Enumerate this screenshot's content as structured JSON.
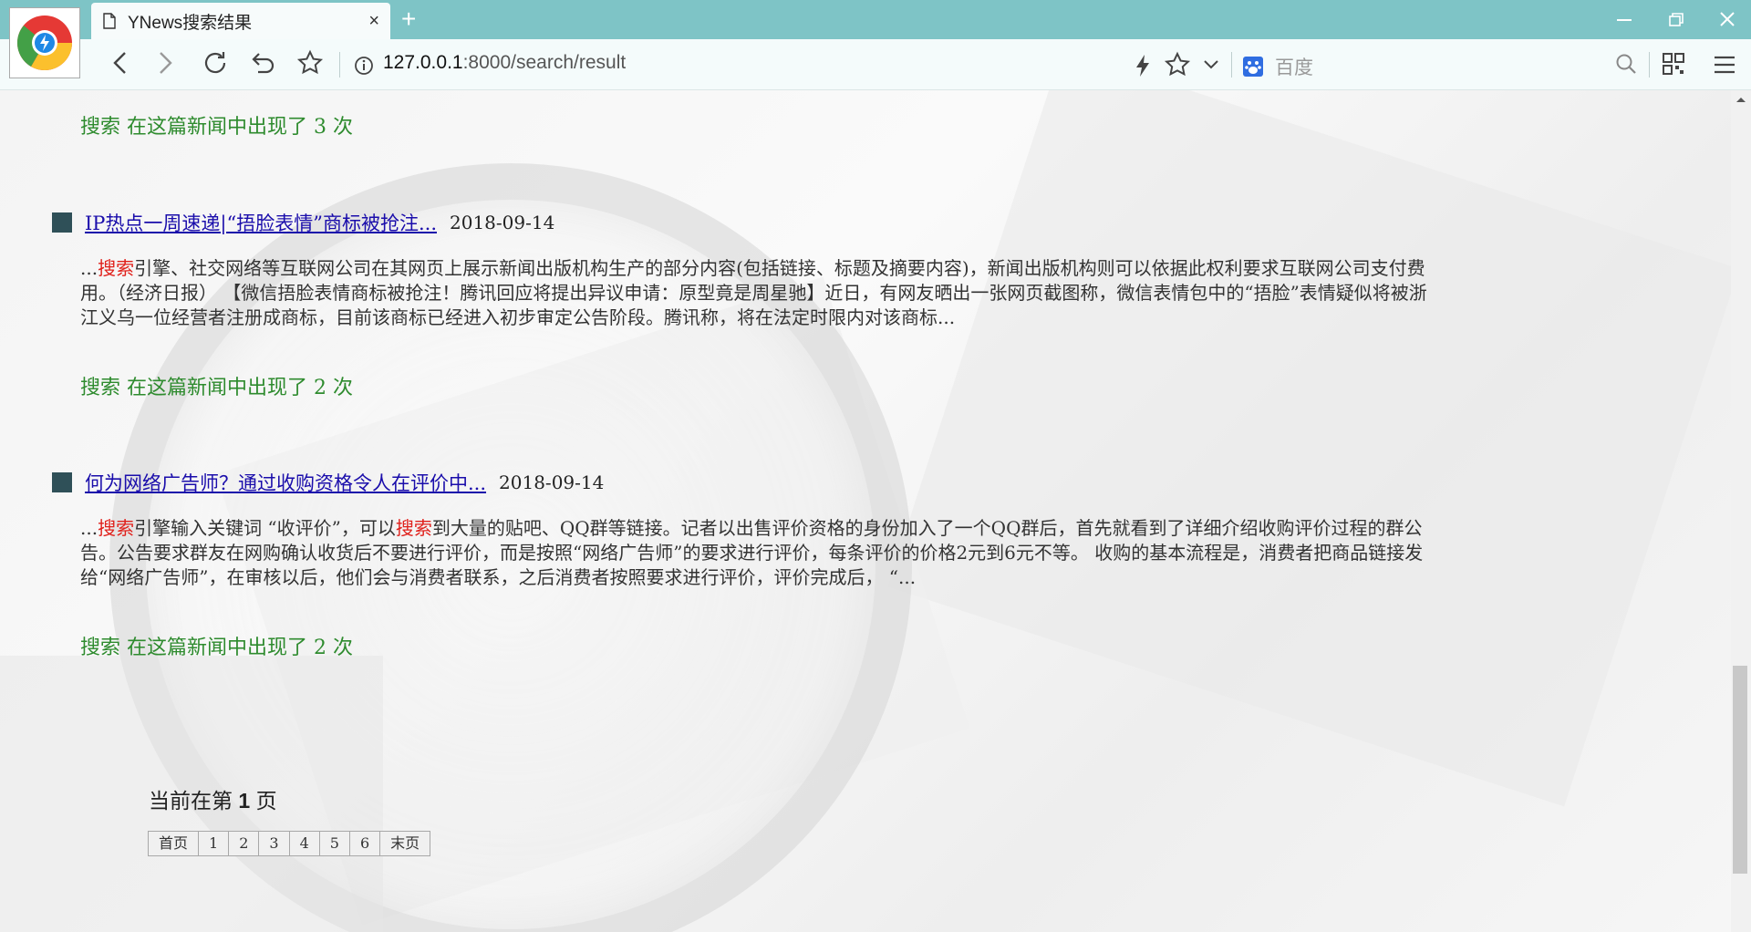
{
  "browser": {
    "tab_title": "YNews搜索结果",
    "tab_close": "×",
    "new_tab": "+",
    "url_host": "127.0.0.1",
    "url_path": ":8000/search/result",
    "search_engine_label": "百度",
    "icons": [
      "back-icon",
      "forward-icon",
      "reload-icon",
      "undo-icon",
      "bookmark-star-icon",
      "info-icon",
      "lightning-icon",
      "star-icon",
      "chevron-down-icon",
      "baidu-icon",
      "search-icon",
      "qrcode-icon",
      "menu-icon"
    ]
  },
  "results": {
    "prev_count": "搜索 在这篇新闻中出现了 3 次",
    "items": [
      {
        "title": "IP热点一周速递|“捂脸表情”商标被抢注...",
        "date": "2018-09-14",
        "snippet": [
          "...",
          "搜索",
          "引擎、社交网络等互联网公司在其网页上展示新闻出版机构生产的部分内容(包括链接、标题及摘要内容)，新闻出版机构则可以依据此权利要求互联网公司支付费用。（经济日报） 【微信捂脸表情商标被抢注！腾讯回应将提出异议申请：原型竟是周星驰】近日，有网友晒出一张网页截图称，微信表情包中的“捂脸”表情疑似将被浙江义乌一位经营者注册成商标，目前该商标已经进入初步审定公告阶段。腾讯称，将在法定时限内对该商标..."
        ],
        "count": "搜索 在这篇新闻中出现了 2 次"
      },
      {
        "title": "何为网络广告师？通过收购资格令人在评价中...",
        "date": "2018-09-14",
        "snippet": [
          "...",
          "搜索",
          "引擎输入关键词 “收评价”，可以",
          "搜索",
          "到大量的贴吧、QQ群等链接。记者以出售评价资格的身份加入了一个QQ群后，首先就看到了详细介绍收购评价过程的群公告。公告要求群友在网购确认收货后不要进行评价，而是按照“网络广告师”的要求进行评价，每条评价的价格2元到6元不等。 收购的基本流程是，消费者把商品链接发给“网络广告师”，在审核以后，他们会与消费者联系，之后消费者按照要求进行评价，评价完成后， “..."
        ],
        "count": "搜索 在这篇新闻中出现了 2 次"
      }
    ]
  },
  "pagination": {
    "prefix": "当前在第",
    "current": "1",
    "suffix": "页",
    "buttons": [
      "首页",
      "1",
      "2",
      "3",
      "4",
      "5",
      "6",
      "末页"
    ]
  }
}
